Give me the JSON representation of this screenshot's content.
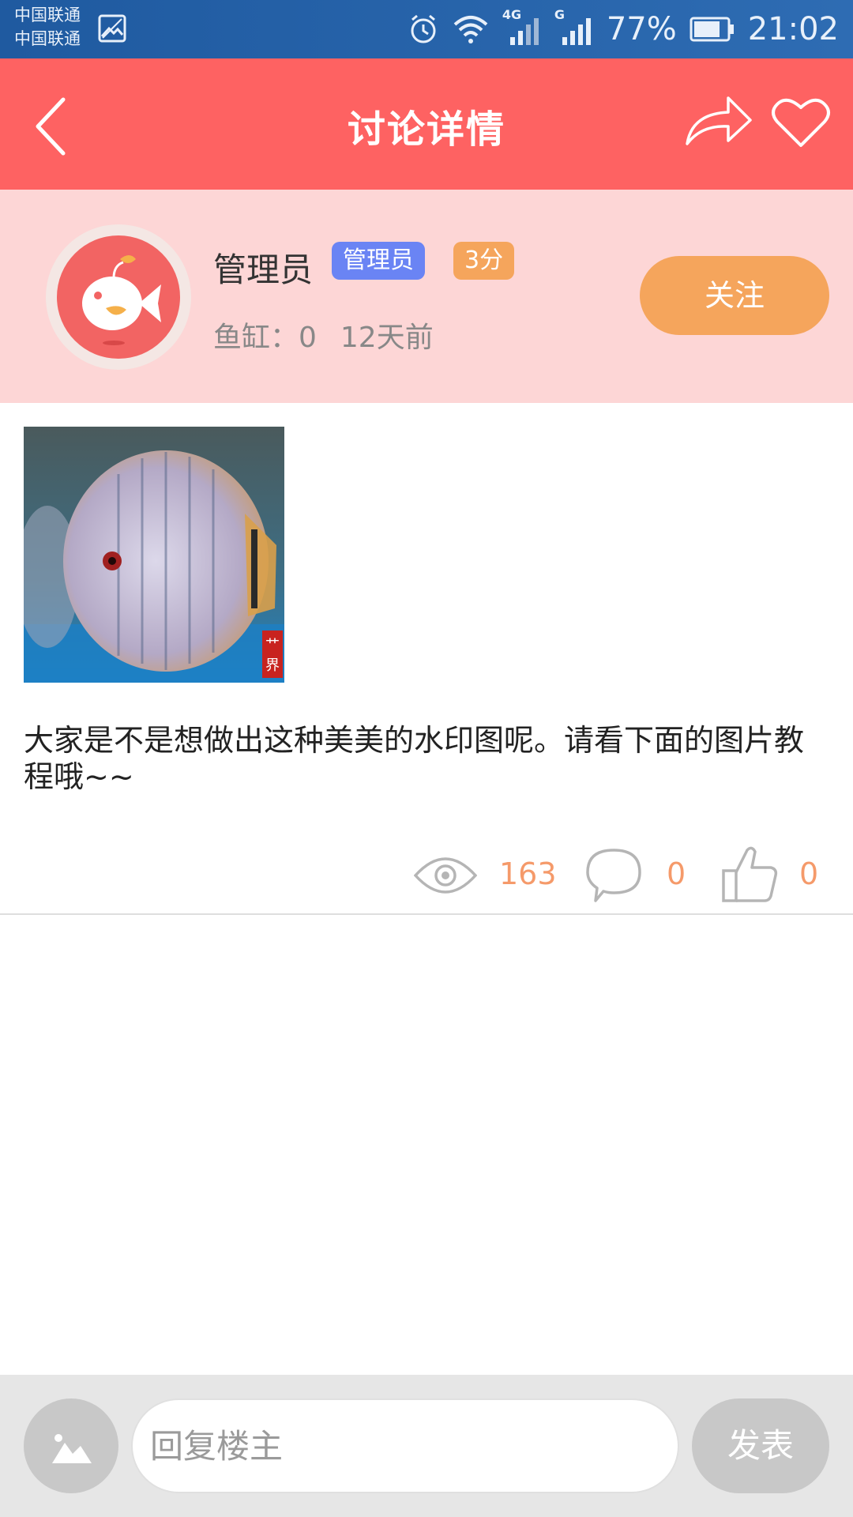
{
  "status_bar": {
    "carrier_1": "中国联通",
    "carrier_2": "中国联通",
    "battery": "77%",
    "time": "21:02",
    "network_1": "4G",
    "network_2": "G"
  },
  "header": {
    "title": "讨论详情"
  },
  "author": {
    "name": "管理员",
    "role_badge": "管理员",
    "score_badge": "3分",
    "tank_label": "鱼缸：0",
    "time_ago": "12天前",
    "follow_label": "关注"
  },
  "post": {
    "text": "大家是不是想做出这种美美的水印图呢。请看下面的图片教程哦~~"
  },
  "stats": {
    "views": "163",
    "comments": "0",
    "likes": "0"
  },
  "reply": {
    "placeholder": "回复楼主",
    "send_label": "发表"
  },
  "colors": {
    "header": "#fe6262",
    "author_bg": "#fdd6d6",
    "accent_orange": "#f5a55c",
    "admin_badge": "#6a84f4"
  }
}
